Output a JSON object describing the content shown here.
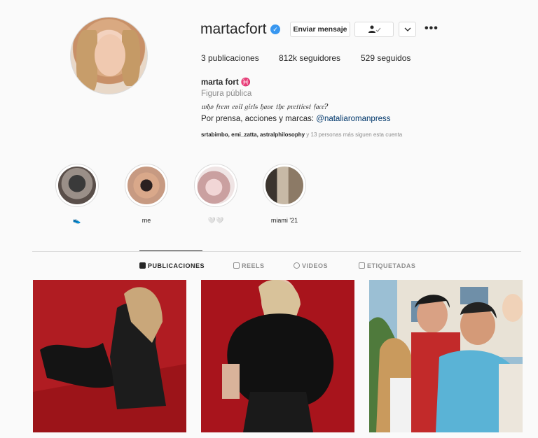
{
  "profile": {
    "username": "martacfort",
    "message_button": "Enviar mensaje",
    "follow_icon": "person-check-icon",
    "dropdown_icon": "chevron-down-icon",
    "more_icon": "more-horizontal-icon",
    "more_label": "•••",
    "stats": {
      "posts": "3 publicaciones",
      "followers": "812k seguidores",
      "following": "529 seguidos"
    },
    "full_name": "marta fort ♓",
    "category": "Figura pública",
    "bio_line1": "𝔴𝔥𝔬 𝔣𝔯𝔢𝔪 𝔢𝔳𝔦𝔩 𝔤𝔦𝔯𝔩𝔰 𝔥𝔞𝔳𝔢 𝔱𝔥𝔢 𝔭𝔯𝔢𝔱𝔱𝔦𝔢𝔰𝔱 𝔣𝔞𝔠𝔢?",
    "bio_line2_text": "Por prensa, acciones y marcas: ",
    "bio_line2_link": "@nataliaromanpress",
    "followed_by_names": "srtabimbo, emi_zatta, astralphilosophy",
    "followed_by_more": " y 13 personas más siguen esta cuenta"
  },
  "highlights": [
    {
      "label": "👟"
    },
    {
      "label": "me"
    },
    {
      "label": "🤍🤍"
    },
    {
      "label": "miami '21"
    }
  ],
  "tabs": [
    {
      "label": "PUBLICACIONES",
      "icon": "grid-icon",
      "active": true
    },
    {
      "label": "REELS",
      "icon": "reels-icon"
    },
    {
      "label": "VIDEOS",
      "icon": "play-icon"
    },
    {
      "label": "ETIQUETADAS",
      "icon": "tag-icon"
    }
  ],
  "colors": {
    "verified": "#3897f0",
    "link": "#00376b",
    "muted": "#8e8e8e"
  }
}
